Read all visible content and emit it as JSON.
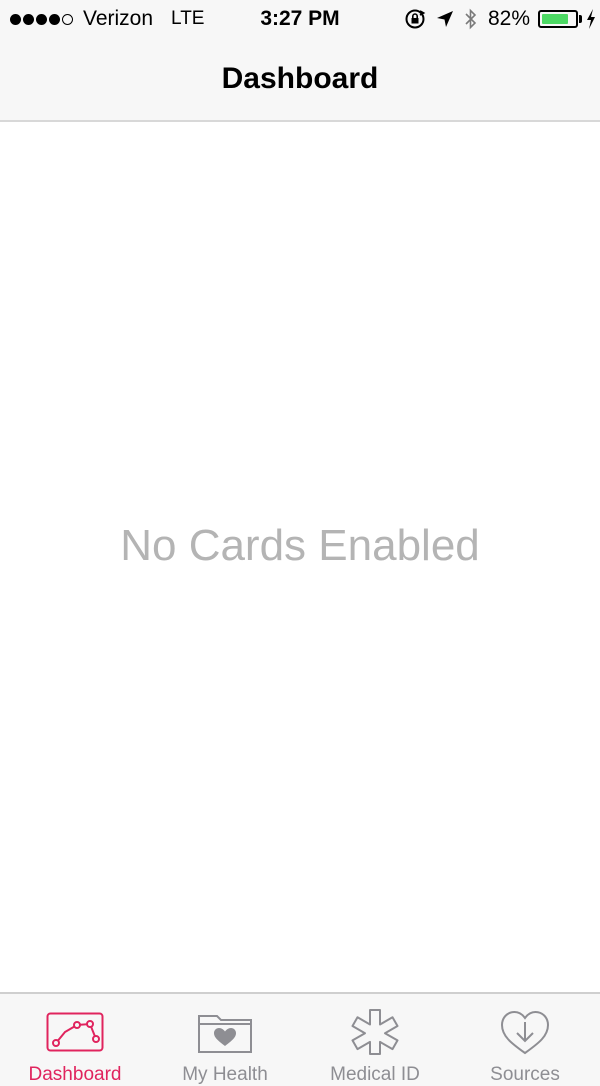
{
  "status_bar": {
    "signal_filled": 4,
    "signal_total": 5,
    "carrier": "Verizon",
    "network": "LTE",
    "time": "3:27 PM",
    "battery_percent": "82%",
    "battery_level": 0.82,
    "icons": [
      "rotation-lock-icon",
      "location-arrow-icon",
      "bluetooth-icon",
      "battery-icon",
      "charging-bolt-icon"
    ]
  },
  "nav": {
    "title": "Dashboard"
  },
  "main": {
    "empty_message": "No Cards Enabled"
  },
  "tabs": [
    {
      "label": "Dashboard",
      "icon": "chart-line-icon",
      "active": true
    },
    {
      "label": "My Health",
      "icon": "heart-folder-icon",
      "active": false
    },
    {
      "label": "Medical ID",
      "icon": "medical-asterisk-icon",
      "active": false
    },
    {
      "label": "Sources",
      "icon": "heart-download-icon",
      "active": false
    }
  ],
  "colors": {
    "accent": "#e0245e",
    "inactive": "#8e8e93",
    "battery": "#4cd964",
    "empty_text": "#b4b4b4"
  }
}
